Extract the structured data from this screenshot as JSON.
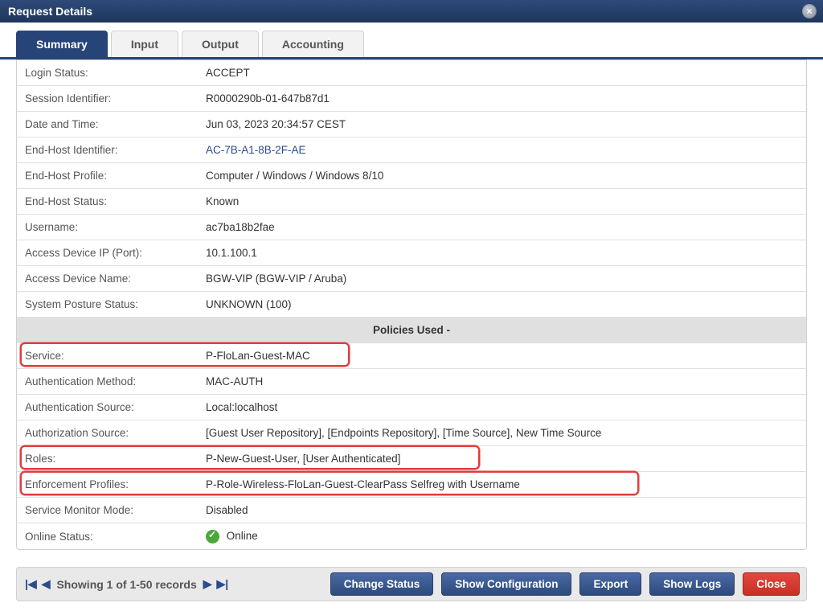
{
  "window": {
    "title": "Request Details"
  },
  "tabs": {
    "summary": "Summary",
    "input": "Input",
    "output": "Output",
    "accounting": "Accounting"
  },
  "summary": {
    "login_status": {
      "label": "Login Status:",
      "value": "ACCEPT"
    },
    "session_id": {
      "label": "Session Identifier:",
      "value": "R0000290b-01-647b87d1"
    },
    "date_time": {
      "label": "Date and Time:",
      "value": "Jun 03, 2023 20:34:57 CEST"
    },
    "end_host_id": {
      "label": "End-Host Identifier:",
      "value": "AC-7B-A1-8B-2F-AE"
    },
    "end_host_profile": {
      "label": "End-Host Profile:",
      "value": "Computer / Windows / Windows 8/10"
    },
    "end_host_status": {
      "label": "End-Host Status:",
      "value": "Known"
    },
    "username": {
      "label": "Username:",
      "value": "ac7ba18b2fae"
    },
    "access_ip": {
      "label": "Access Device IP (Port):",
      "value": "10.1.100.1"
    },
    "access_name": {
      "label": "Access Device Name:",
      "value": "BGW-VIP (BGW-VIP / Aruba)"
    },
    "posture": {
      "label": "System Posture Status:",
      "value": "UNKNOWN (100)"
    }
  },
  "policies_header": "Policies Used -",
  "policies": {
    "service": {
      "label": "Service:",
      "value": "P-FloLan-Guest-MAC"
    },
    "auth_method": {
      "label": "Authentication Method:",
      "value": "MAC-AUTH"
    },
    "auth_source": {
      "label": "Authentication Source:",
      "value": "Local:localhost"
    },
    "authz_source": {
      "label": "Authorization Source:",
      "value": "[Guest User Repository], [Endpoints Repository], [Time Source], New Time Source"
    },
    "roles": {
      "label": "Roles:",
      "value": "P-New-Guest-User, [User Authenticated]"
    },
    "enf_profiles": {
      "label": "Enforcement Profiles:",
      "value": "P-Role-Wireless-FloLan-Guest-ClearPass Selfreg with Username"
    },
    "svc_monitor": {
      "label": "Service Monitor Mode:",
      "value": "Disabled"
    },
    "online": {
      "label": "Online Status:",
      "value": "Online"
    }
  },
  "footer": {
    "pager_text": "Showing 1 of 1-50 records",
    "buttons": {
      "change_status": "Change Status",
      "show_config": "Show Configuration",
      "export": "Export",
      "show_logs": "Show Logs",
      "close": "Close"
    }
  }
}
